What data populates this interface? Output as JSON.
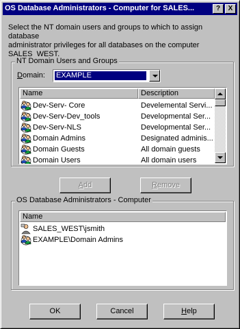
{
  "window": {
    "title": "OS Database Administrators - Computer for SALES...",
    "help_button": "?",
    "close_button": "X"
  },
  "instructions": "Select the NT domain users and groups to which to assign database\nadministrator privileges for all databases on the computer\nSALES_WEST.",
  "nt_group": {
    "label": "NT Domain Users and Groups",
    "domain_label_first": "D",
    "domain_label_rest": "omain:",
    "domain_value": "EXAMPLE",
    "columns": [
      "Name",
      "Description"
    ],
    "rows": [
      {
        "name": "Dev-Serv- Core",
        "description": "Develemental Servi..."
      },
      {
        "name": "Dev-Serv-Dev_tools",
        "description": "Developmental Ser..."
      },
      {
        "name": "Dev-Serv-NLS",
        "description": "Developmental Ser..."
      },
      {
        "name": "Domain Admins",
        "description": "Designated adminis..."
      },
      {
        "name": "Domain Guests",
        "description": "All domain guests"
      },
      {
        "name": "Domain Users",
        "description": "All domain users"
      }
    ]
  },
  "buttons": {
    "add_first": "A",
    "add_rest": "dd",
    "remove_first": "R",
    "remove_rest": "emove",
    "ok": "OK",
    "cancel": "Cancel",
    "help_first": "H",
    "help_rest": "elp"
  },
  "os_group": {
    "label": "OS Database Administrators - Computer",
    "columns": [
      "Name"
    ],
    "rows": [
      {
        "name": "SALES_WEST\\jsmith",
        "icon": "user-icon"
      },
      {
        "name": "EXAMPLE\\Domain Admins",
        "icon": "group-icon"
      }
    ]
  }
}
